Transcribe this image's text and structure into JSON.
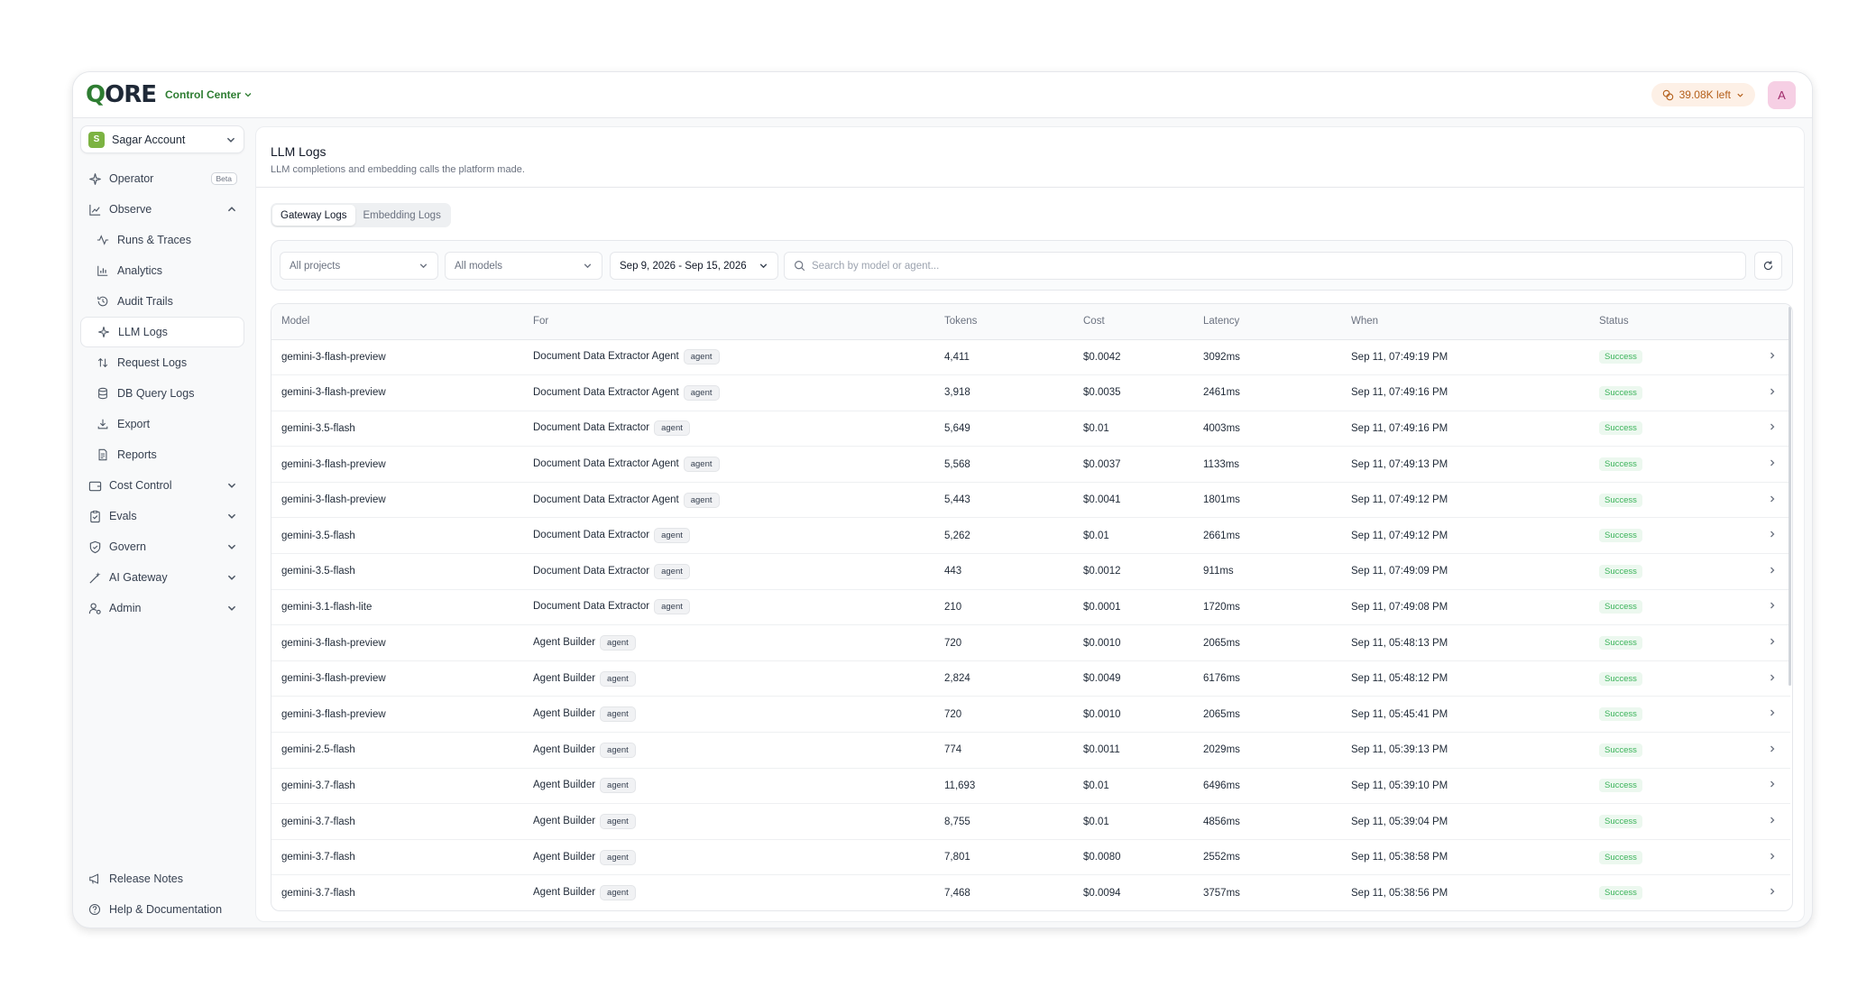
{
  "header": {
    "logo_q": "Q",
    "logo_rest": "ORE",
    "section": "Control Center",
    "credits": "39.08K left",
    "avatar_initial": "A"
  },
  "sidebar": {
    "account_initial": "S",
    "account_name": "Sagar Account",
    "items": [
      {
        "label": "Operator",
        "badge": "Beta",
        "icon": "sparkle-icon"
      },
      {
        "label": "Observe",
        "icon": "chart-icon"
      },
      {
        "label": "Runs & Traces",
        "icon": "activity-icon"
      },
      {
        "label": "Analytics",
        "icon": "bar-chart-icon"
      },
      {
        "label": "Audit Trails",
        "icon": "history-icon"
      },
      {
        "label": "LLM Logs",
        "icon": "sparkle-icon"
      },
      {
        "label": "Request Logs",
        "icon": "arrows-updown-icon"
      },
      {
        "label": "DB Query Logs",
        "icon": "database-icon"
      },
      {
        "label": "Export",
        "icon": "download-icon"
      },
      {
        "label": "Reports",
        "icon": "file-icon"
      },
      {
        "label": "Cost Control",
        "icon": "wallet-icon"
      },
      {
        "label": "Evals",
        "icon": "clipboard-check-icon"
      },
      {
        "label": "Govern",
        "icon": "shield-check-icon"
      },
      {
        "label": "AI Gateway",
        "icon": "wand-icon"
      },
      {
        "label": "Admin",
        "icon": "users-cog-icon"
      }
    ],
    "bottom": [
      {
        "label": "Release Notes",
        "icon": "megaphone-icon"
      },
      {
        "label": "Help & Documentation",
        "icon": "help-circle-icon"
      }
    ]
  },
  "page": {
    "title": "LLM Logs",
    "subtitle": "LLM completions and embedding calls the platform made."
  },
  "tabs": [
    "Gateway Logs",
    "Embedding Logs"
  ],
  "filters": {
    "project": "All projects",
    "model": "All models",
    "date_range": "Sep 9, 2026 - Sep 15, 2026",
    "search_placeholder": "Search by model or agent..."
  },
  "table": {
    "columns": [
      "Model",
      "For",
      "Tokens",
      "Cost",
      "Latency",
      "When",
      "Status"
    ],
    "rows": [
      {
        "model": "gemini-3-flash-preview",
        "for": "Document Data Extractor Agent",
        "tag": "agent",
        "tokens": "4,411",
        "cost": "$0.0042",
        "latency": "3092ms",
        "when": "Sep 11, 07:49:19 PM",
        "status": "Success"
      },
      {
        "model": "gemini-3-flash-preview",
        "for": "Document Data Extractor Agent",
        "tag": "agent",
        "tokens": "3,918",
        "cost": "$0.0035",
        "latency": "2461ms",
        "when": "Sep 11, 07:49:16 PM",
        "status": "Success"
      },
      {
        "model": "gemini-3.5-flash",
        "for": "Document Data Extractor",
        "tag": "agent",
        "tokens": "5,649",
        "cost": "$0.01",
        "latency": "4003ms",
        "when": "Sep 11, 07:49:16 PM",
        "status": "Success"
      },
      {
        "model": "gemini-3-flash-preview",
        "for": "Document Data Extractor Agent",
        "tag": "agent",
        "tokens": "5,568",
        "cost": "$0.0037",
        "latency": "1133ms",
        "when": "Sep 11, 07:49:13 PM",
        "status": "Success"
      },
      {
        "model": "gemini-3-flash-preview",
        "for": "Document Data Extractor Agent",
        "tag": "agent",
        "tokens": "5,443",
        "cost": "$0.0041",
        "latency": "1801ms",
        "when": "Sep 11, 07:49:12 PM",
        "status": "Success"
      },
      {
        "model": "gemini-3.5-flash",
        "for": "Document Data Extractor",
        "tag": "agent",
        "tokens": "5,262",
        "cost": "$0.01",
        "latency": "2661ms",
        "when": "Sep 11, 07:49:12 PM",
        "status": "Success"
      },
      {
        "model": "gemini-3.5-flash",
        "for": "Document Data Extractor",
        "tag": "agent",
        "tokens": "443",
        "cost": "$0.0012",
        "latency": "911ms",
        "when": "Sep 11, 07:49:09 PM",
        "status": "Success"
      },
      {
        "model": "gemini-3.1-flash-lite",
        "for": "Document Data Extractor",
        "tag": "agent",
        "tokens": "210",
        "cost": "$0.0001",
        "latency": "1720ms",
        "when": "Sep 11, 07:49:08 PM",
        "status": "Success"
      },
      {
        "model": "gemini-3-flash-preview",
        "for": "Agent Builder",
        "tag": "agent",
        "tokens": "720",
        "cost": "$0.0010",
        "latency": "2065ms",
        "when": "Sep 11, 05:48:13 PM",
        "status": "Success"
      },
      {
        "model": "gemini-3-flash-preview",
        "for": "Agent Builder",
        "tag": "agent",
        "tokens": "2,824",
        "cost": "$0.0049",
        "latency": "6176ms",
        "when": "Sep 11, 05:48:12 PM",
        "status": "Success"
      },
      {
        "model": "gemini-3-flash-preview",
        "for": "Agent Builder",
        "tag": "agent",
        "tokens": "720",
        "cost": "$0.0010",
        "latency": "2065ms",
        "when": "Sep 11, 05:45:41 PM",
        "status": "Success"
      },
      {
        "model": "gemini-2.5-flash",
        "for": "Agent Builder",
        "tag": "agent",
        "tokens": "774",
        "cost": "$0.0011",
        "latency": "2029ms",
        "when": "Sep 11, 05:39:13 PM",
        "status": "Success"
      },
      {
        "model": "gemini-3.7-flash",
        "for": "Agent Builder",
        "tag": "agent",
        "tokens": "11,693",
        "cost": "$0.01",
        "latency": "6496ms",
        "when": "Sep 11, 05:39:10 PM",
        "status": "Success"
      },
      {
        "model": "gemini-3.7-flash",
        "for": "Agent Builder",
        "tag": "agent",
        "tokens": "8,755",
        "cost": "$0.01",
        "latency": "4856ms",
        "when": "Sep 11, 05:39:04 PM",
        "status": "Success"
      },
      {
        "model": "gemini-3.7-flash",
        "for": "Agent Builder",
        "tag": "agent",
        "tokens": "7,801",
        "cost": "$0.0080",
        "latency": "2552ms",
        "when": "Sep 11, 05:38:58 PM",
        "status": "Success"
      },
      {
        "model": "gemini-3.7-flash",
        "for": "Agent Builder",
        "tag": "agent",
        "tokens": "7,468",
        "cost": "$0.0094",
        "latency": "3757ms",
        "when": "Sep 11, 05:38:56 PM",
        "status": "Success"
      }
    ]
  },
  "colors": {
    "brand": "#2e7d32",
    "status_success_bg": "#ecf8ef",
    "status_success_text": "#3bb35a",
    "credits_bg": "#fdf0e6"
  }
}
